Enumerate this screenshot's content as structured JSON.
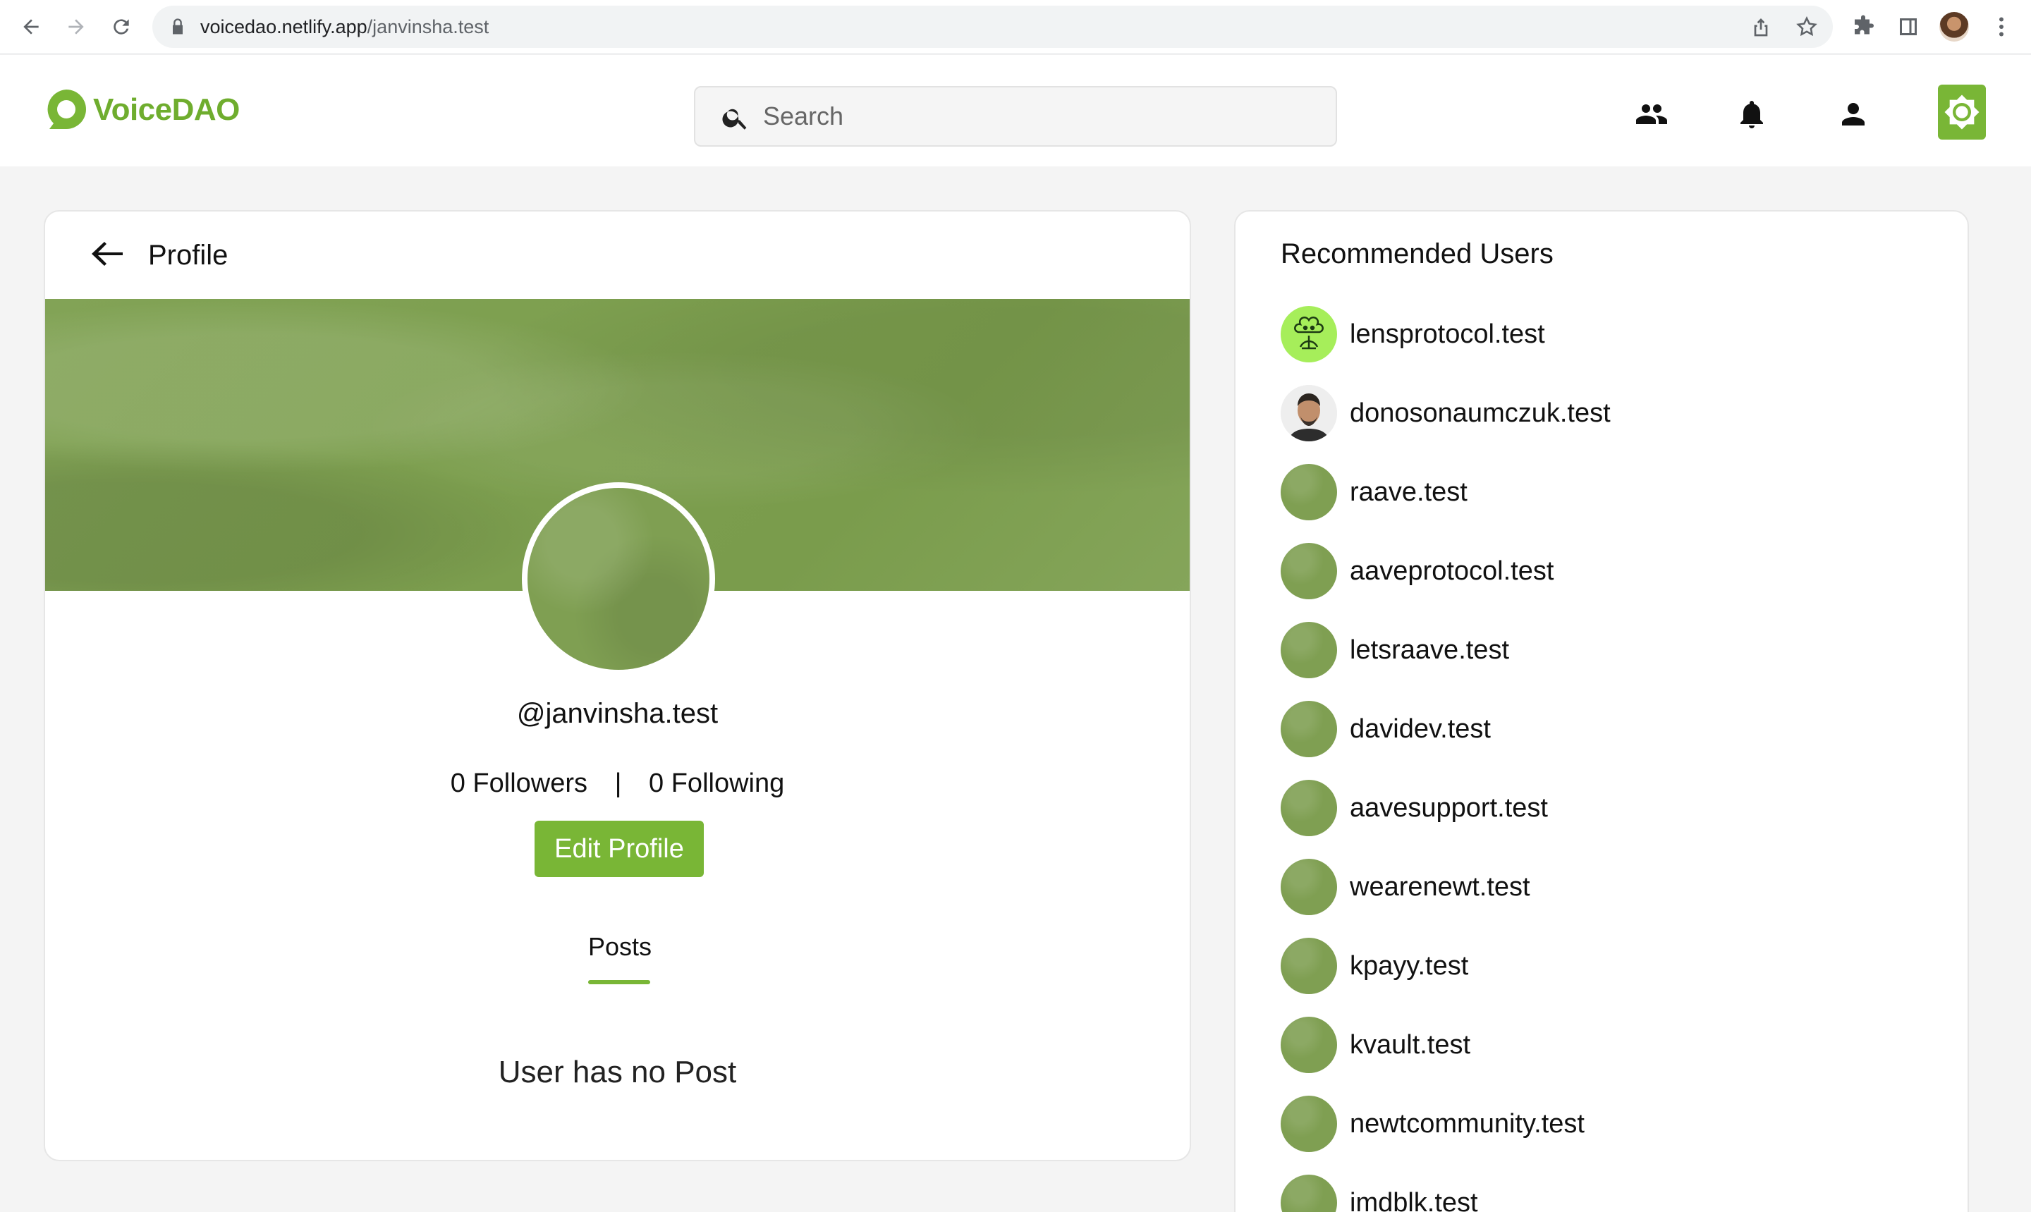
{
  "browser": {
    "url_host": "voicedao.netlify.app",
    "url_path": "/janvinsha.test"
  },
  "header": {
    "logo_text": "VoiceDAO",
    "search_placeholder": "Search",
    "accent_color": "#79b636"
  },
  "profile": {
    "title": "Profile",
    "handle": "@janvinsha.test",
    "followers_label": "0 Followers",
    "separator": "|",
    "following_label": "0 Following",
    "edit_button": "Edit Profile",
    "tab_posts": "Posts",
    "empty_message": "User has no Post"
  },
  "recommended": {
    "title": "Recommended Users",
    "users": [
      {
        "name": "lensprotocol.test",
        "avatar": "lens-logo"
      },
      {
        "name": "donosonaumczuk.test",
        "avatar": "photo"
      },
      {
        "name": "raave.test",
        "avatar": "green"
      },
      {
        "name": "aaveprotocol.test",
        "avatar": "green"
      },
      {
        "name": "letsraave.test",
        "avatar": "green"
      },
      {
        "name": "davidev.test",
        "avatar": "green"
      },
      {
        "name": "aavesupport.test",
        "avatar": "green"
      },
      {
        "name": "wearenewt.test",
        "avatar": "green"
      },
      {
        "name": "kpayy.test",
        "avatar": "green"
      },
      {
        "name": "kvault.test",
        "avatar": "green"
      },
      {
        "name": "newtcommunity.test",
        "avatar": "green"
      },
      {
        "name": "imdblk.test",
        "avatar": "green"
      }
    ]
  }
}
